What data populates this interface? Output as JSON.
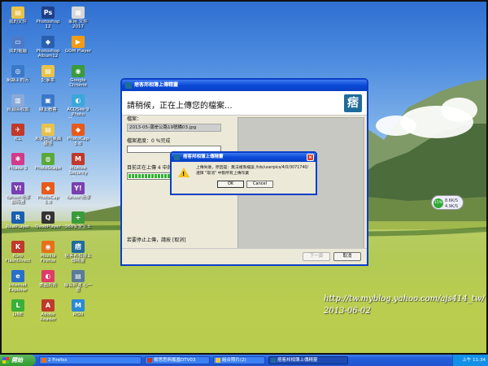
{
  "desktop": {
    "icons": [
      {
        "label": "我的文件",
        "color": "#e8c24a",
        "glyph": "▤"
      },
      {
        "label": "Photoshop\n12",
        "color": "#1f3f8a",
        "glyph": "Ps"
      },
      {
        "label": "家用 文件 2017",
        "color": "#d7d7d7",
        "glyph": "▦"
      },
      {
        "label": "我的電腦",
        "color": "#4b7ac9",
        "glyph": "▭"
      },
      {
        "label": "Photoshop Album12",
        "color": "#2a5fb0",
        "glyph": "◆"
      },
      {
        "label": "GOM Player",
        "color": "#f29b16",
        "glyph": "▶"
      },
      {
        "label": "網路上的芳",
        "color": "#3a78c9",
        "glyph": "◎"
      },
      {
        "label": "記事本",
        "color": "#e8c24a",
        "glyph": "▤"
      },
      {
        "label": "Google Chrome",
        "color": "#3a9b3a",
        "glyph": "◉"
      },
      {
        "label": "資源回收筒",
        "color": "#8aa9d8",
        "glyph": "▥"
      },
      {
        "label": "線上看書",
        "color": "#3a78c9",
        "glyph": "▣"
      },
      {
        "label": "ACDSee 9 Photo Manager",
        "color": "#3aa8d8",
        "glyph": "◐"
      },
      {
        "label": "ICL",
        "color": "#c0392b",
        "glyph": "✈"
      },
      {
        "label": "未使用的桌面捷徑",
        "color": "#e8c24a",
        "glyph": "▤"
      },
      {
        "label": "PhotoCap 5.0",
        "color": "#e85a1a",
        "glyph": "◆"
      },
      {
        "label": "Picasa 3",
        "color": "#d23a8a",
        "glyph": "✱"
      },
      {
        "label": "PhotoScape",
        "color": "#5aa83a",
        "glyph": "◍"
      },
      {
        "label": "McAfee Security Scan",
        "color": "#c0392b",
        "glyph": "M"
      },
      {
        "label": "Yahoo!奇摩 即時通",
        "color": "#7a3fb0",
        "glyph": "Y!"
      },
      {
        "label": "PhotoCap 5.0",
        "color": "#e85a1a",
        "glyph": "◆"
      },
      {
        "label": "Yahoo!奇摩",
        "color": "#7a3fb0",
        "glyph": "Y!"
      },
      {
        "label": "RealPlayer",
        "color": "#1a5fb0",
        "glyph": "R"
      },
      {
        "label": "QvodPlayer",
        "color": "#333333",
        "glyph": "Q"
      },
      {
        "label": "360安全卫士",
        "color": "#3a9b3a",
        "glyph": "+"
      },
      {
        "label": "Kuro FlashDirect",
        "color": "#c0392b",
        "glyph": "K"
      },
      {
        "label": "Mozilla Firefox",
        "color": "#e8701a",
        "glyph": "◉"
      },
      {
        "label": "痞客邦相簿上傳精靈",
        "color": "#1f6b9c",
        "glyph": "痞"
      },
      {
        "label": "Internet Explorer",
        "color": "#2a6fc9",
        "glyph": "e"
      },
      {
        "label": "美圖秀秀",
        "color": "#e03a6a",
        "glyph": "◐"
      },
      {
        "label": "聯合好運 心一意",
        "color": "#5a7a9a",
        "glyph": "▤"
      },
      {
        "label": "LINE",
        "color": "#3ab03a",
        "glyph": "L"
      },
      {
        "label": "Adobe Reader",
        "color": "#c0392b",
        "glyph": "A"
      },
      {
        "label": "MSN",
        "color": "#2a8ad8",
        "glyph": "M"
      }
    ],
    "watermark_url": "http://tw.myblog.yahoo.com/ajs414_tw/",
    "watermark_date": "2013-06-02",
    "gadget": {
      "percent": "15%",
      "up": "8.6K/S",
      "down": "4.9K/S"
    }
  },
  "window": {
    "title": "痞客邦相簿上傳精靈",
    "heading": "請稍候，正在上傳您的檔案...",
    "logo": "痞",
    "file_label": "檔案：",
    "file_name": "2013-05-潮岸公路19號橋03.jpg",
    "progress_label": "檔案進度：0 %完成",
    "overall_label": "目前正在上傳 4 中的第",
    "overall_progress_percent": 55,
    "stop_text": "若要停止上傳，請按 [取消]",
    "next_button": "下一頁",
    "cancel_button": "取消"
  },
  "dialog": {
    "title": "痞客邦相簿上傳精靈",
    "line1": "上傳失敗，原因是：無法複製檔案 /tds/userpics/4/0/3071740/",
    "line2": "選擇 \"取消\" 中斷所有上傳作業",
    "ok_button": "OK",
    "cancel_button": "Cancel"
  },
  "taskbar": {
    "start_label": "開始",
    "tasks": [
      {
        "label": "2 Firefox",
        "color": "#e8701a",
        "active": false
      },
      {
        "label": "楊思思與鳳凰DTV03",
        "color": "#c0392b",
        "active": false
      },
      {
        "label": "組合照片(2)",
        "color": "#e8c24a",
        "active": false
      },
      {
        "label": "痞客邦相簿上傳精靈",
        "color": "#1f6b9c",
        "active": true
      }
    ],
    "clock": "上午 11:34"
  }
}
